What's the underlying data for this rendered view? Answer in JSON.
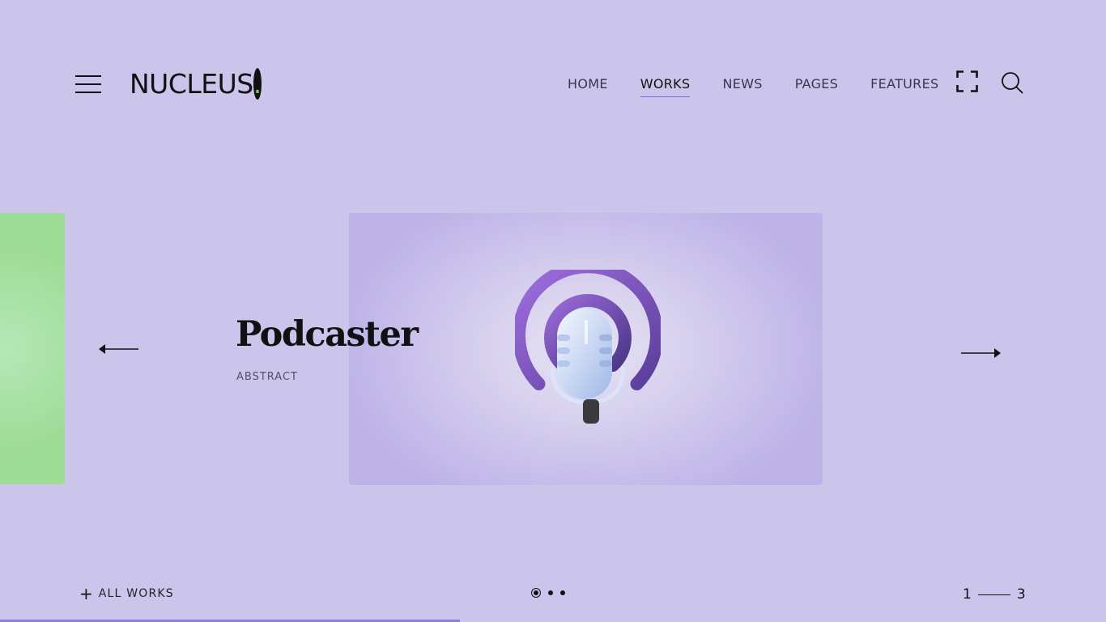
{
  "logo": {
    "text": "NUCLEUS",
    "dot": "."
  },
  "nav": [
    {
      "label": "HOME",
      "active": false
    },
    {
      "label": "WORKS",
      "active": true
    },
    {
      "label": "NEWS",
      "active": false
    },
    {
      "label": "PAGES",
      "active": false
    },
    {
      "label": "FEATURES",
      "active": false
    }
  ],
  "header_icons": [
    "menu-icon",
    "fullscreen-icon",
    "search-icon"
  ],
  "slide": {
    "title": "Podcaster",
    "category": "ABSTRACT",
    "image_subject": "microphone-icon"
  },
  "footer": {
    "all_works_icon": "plus-icon",
    "all_works_label": "ALL WORKS",
    "counter_current": "1",
    "counter_total": "3",
    "slide_dots": 3,
    "active_dot": 1
  },
  "progress": 0.416,
  "colors": {
    "background": "#cbc5eb",
    "accent": "#8f7de6",
    "logo_dot": "#7dc242",
    "prev_slide": "#9ddc94"
  }
}
